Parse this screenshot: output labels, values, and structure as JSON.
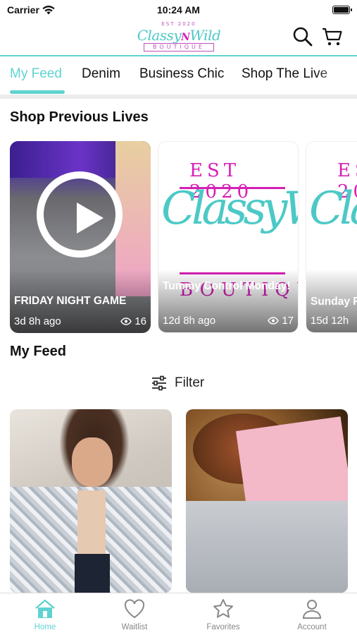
{
  "status_bar": {
    "carrier": "Carrier",
    "time": "10:24 AM"
  },
  "header": {
    "logo": {
      "est": "EST 2020",
      "name_left": "Classy",
      "name_n": "N",
      "name_right": "Wild",
      "sub": "BOUTIQUE"
    },
    "search_icon": "search-icon",
    "cart_icon": "cart-icon"
  },
  "tabs": [
    {
      "label": "My Feed",
      "active": true
    },
    {
      "label": "Denim",
      "active": false
    },
    {
      "label": "Business Chic",
      "active": false
    },
    {
      "label": "Shop The Live",
      "active": false
    }
  ],
  "previous_lives": {
    "title": "Shop Previous Lives",
    "cards": [
      {
        "title": "FRIDAY NIGHT GAME",
        "time": "3d 8h ago",
        "views": "16"
      },
      {
        "title": "Tummy Control Monday!",
        "time": "12d 8h ago",
        "views": "17"
      },
      {
        "title": "Sunday F",
        "time": "15d 12h"
      }
    ]
  },
  "feed": {
    "title": "My Feed",
    "filter_label": "Filter"
  },
  "bottom_nav": [
    {
      "label": "Home",
      "active": true
    },
    {
      "label": "Waitlist",
      "active": false
    },
    {
      "label": "Favorites",
      "active": false
    },
    {
      "label": "Account",
      "active": false
    }
  ],
  "colors": {
    "accent": "#5fd3d0",
    "brand_pink": "#d61fb6",
    "brand_teal": "#4cc9c6"
  }
}
